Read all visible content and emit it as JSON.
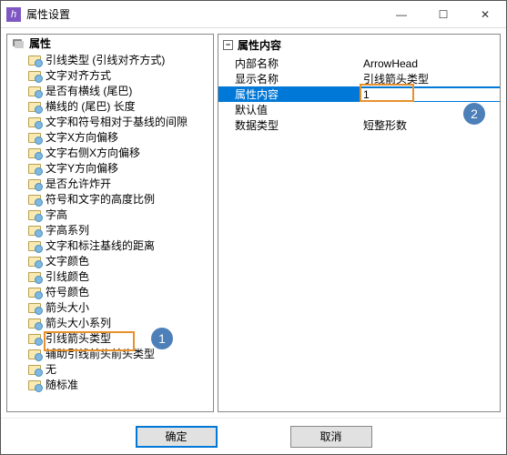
{
  "window": {
    "title": "属性设置"
  },
  "left": {
    "header": "属性",
    "items": [
      "引线类型 (引线对齐方式)",
      "文字对齐方式",
      "是否有横线 (尾巴)",
      "横线的 (尾巴) 长度",
      "文字和符号相对于基线的间隙",
      "文字X方向偏移",
      "文字右侧X方向偏移",
      "文字Y方向偏移",
      "是否允许炸开",
      "符号和文字的高度比例",
      "字高",
      "字高系列",
      "文字和标注基线的距离",
      "文字颜色",
      "引线颜色",
      "符号颜色",
      "箭头大小",
      "箭头大小系列",
      "引线箭头类型",
      "辅助引线前头前头类型",
      "无",
      "随标准"
    ]
  },
  "right": {
    "header": "属性内容",
    "rows": [
      {
        "label": "内部名称",
        "value": "ArrowHead"
      },
      {
        "label": "显示名称",
        "value": "引线箭头类型"
      },
      {
        "label": "属性内容",
        "value": "1"
      },
      {
        "label": "默认值",
        "value": ""
      },
      {
        "label": "数据类型",
        "value": "短整形数"
      }
    ],
    "selected_index": 2
  },
  "buttons": {
    "ok": "确定",
    "cancel": "取消"
  },
  "annotations": {
    "badge1": "1",
    "badge2": "2"
  }
}
